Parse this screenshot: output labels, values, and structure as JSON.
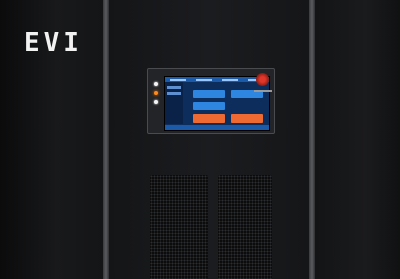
{
  "brand": {
    "logo_text": "EVI"
  },
  "colors": {
    "cabinet": "#151618",
    "accent_blue": "#2f86e0",
    "accent_orange": "#ef6a33",
    "estop_red": "#e0372a"
  },
  "panel": {
    "indicator_leds": [
      "white",
      "orange",
      "white"
    ],
    "display": {
      "buttons": [
        "blue",
        "blue",
        "blue",
        "orange",
        "orange"
      ]
    }
  }
}
